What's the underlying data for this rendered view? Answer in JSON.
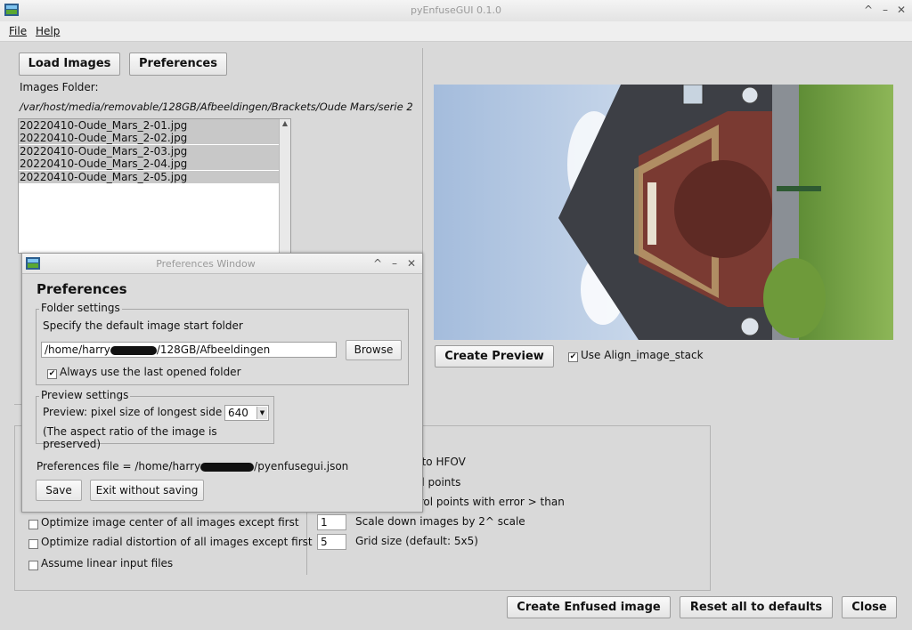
{
  "window": {
    "title": "pyEnfuseGUI 0.1.0"
  },
  "menu": {
    "file": "File",
    "help": "Help"
  },
  "toolbar": {
    "load_images": "Load Images",
    "preferences": "Preferences"
  },
  "images": {
    "folder_label": "Images Folder:",
    "folder_path": "/var/host/media/removable/128GB/Afbeeldingen/Brackets/Oude Mars/serie 2",
    "files": [
      "20220410-Oude_Mars_2-01.jpg",
      "20220410-Oude_Mars_2-02.jpg",
      "20220410-Oude_Mars_2-03.jpg",
      "20220410-Oude_Mars_2-04.jpg",
      "20220410-Oude_Mars_2-05.jpg"
    ]
  },
  "preview": {
    "create_preview": "Create Preview",
    "align_label": "Use Align_image_stack",
    "align_checked": true
  },
  "options_left": [
    {
      "label": "Optimize image center of all images except first",
      "checked": false
    },
    {
      "label": "Optimize radial distortion of all images except first",
      "checked": false
    },
    {
      "label": "Assume linear input files",
      "checked": false
    }
  ],
  "options_right": {
    "partial_1": "uto HFOV",
    "partial_2": "ol points",
    "partial_3": "trol points with error > than",
    "scale_value": "1",
    "scale_label": "Scale down images by 2^ scale",
    "grid_value": "5",
    "grid_label": "Grid size (default: 5x5)"
  },
  "bottom": {
    "create_enfused": "Create Enfused image",
    "reset": "Reset all to defaults",
    "close": "Close"
  },
  "dialog": {
    "title": "Preferences Window",
    "heading": "Preferences",
    "folder_group": "Folder settings",
    "folder_desc": "Specify the default image start folder",
    "folder_value": "/home/harry",
    "folder_value_tail": "/128GB/Afbeeldingen",
    "browse": "Browse",
    "always_last": "Always use the last opened folder",
    "always_last_checked": true,
    "preview_group": "Preview settings",
    "pixel_label": "Preview: pixel size of longest side",
    "pixel_value": "640",
    "aspect_note": "(The aspect ratio of the image is preserved)",
    "prefs_file_label": "Preferences file = /home/harry",
    "prefs_file_tail": "/pyenfusegui.json",
    "save": "Save",
    "exit": "Exit without saving"
  },
  "colors": {
    "background": "#d9d9d9",
    "list_selected": "#c8c8c8",
    "sky": "#a8c0df",
    "grass": "#6f9a3e",
    "brick": "#7b3b33"
  }
}
